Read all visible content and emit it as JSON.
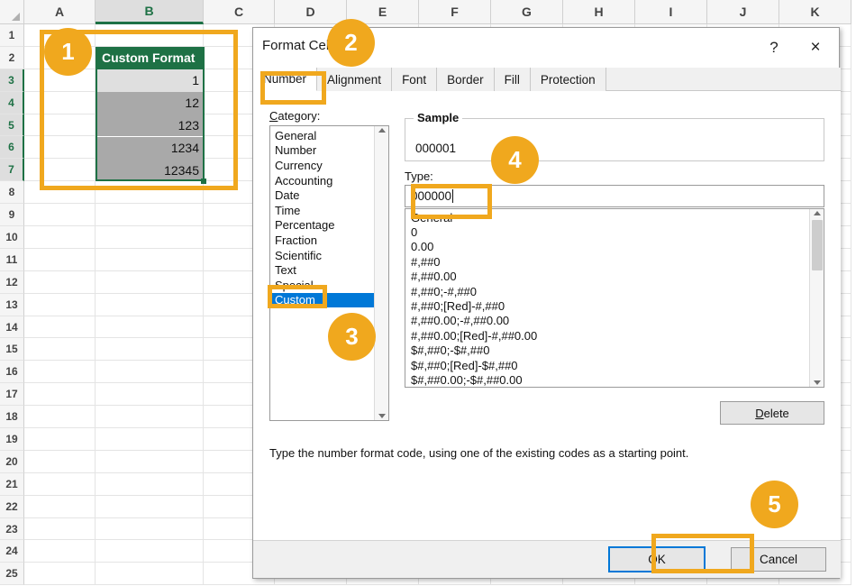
{
  "spreadsheet": {
    "columns": [
      "A",
      "B",
      "C",
      "D",
      "E",
      "F",
      "G",
      "H",
      "I",
      "J",
      "K"
    ],
    "selected_column": "B",
    "rows": [
      "1",
      "2",
      "3",
      "4",
      "5",
      "6",
      "7",
      "8",
      "9",
      "10",
      "11",
      "12",
      "13",
      "14",
      "15",
      "16",
      "17",
      "18",
      "19",
      "20",
      "21",
      "22",
      "23",
      "24",
      "25"
    ],
    "selected_rows": [
      "3",
      "4",
      "5",
      "6",
      "7"
    ],
    "header_cell": {
      "value": "Custom Format",
      "bg": "#1e7145",
      "fg": "#ffffff"
    },
    "data_cells": [
      {
        "row": "3",
        "value": "1",
        "state": "active"
      },
      {
        "row": "4",
        "value": "12",
        "state": "selected"
      },
      {
        "row": "5",
        "value": "123",
        "state": "selected"
      },
      {
        "row": "6",
        "value": "1234",
        "state": "selected"
      },
      {
        "row": "7",
        "value": "12345",
        "state": "selected"
      }
    ]
  },
  "dialog": {
    "title": "Format Cells",
    "help_icon": "?",
    "close_icon": "×",
    "tabs": [
      {
        "label": "Number",
        "active": true
      },
      {
        "label": "Alignment",
        "active": false
      },
      {
        "label": "Font",
        "active": false
      },
      {
        "label": "Border",
        "active": false
      },
      {
        "label": "Fill",
        "active": false
      },
      {
        "label": "Protection",
        "active": false
      }
    ],
    "category": {
      "label": "Category:",
      "items": [
        "General",
        "Number",
        "Currency",
        "Accounting",
        "Date",
        "Time",
        "Percentage",
        "Fraction",
        "Scientific",
        "Text",
        "Special",
        "Custom"
      ],
      "selected": "Custom"
    },
    "sample": {
      "legend": "Sample",
      "value": "000001"
    },
    "type": {
      "label": "Type:",
      "value": "000000"
    },
    "format_codes": [
      "General",
      "0",
      "0.00",
      "#,##0",
      "#,##0.00",
      "#,##0;-#,##0",
      "#,##0;[Red]-#,##0",
      "#,##0.00;-#,##0.00",
      "#,##0.00;[Red]-#,##0.00",
      "$#,##0;-$#,##0",
      "$#,##0;[Red]-$#,##0",
      "$#,##0.00;-$#,##0.00"
    ],
    "delete_label": "Delete",
    "hint": "Type the number format code, using one of the existing codes as a starting point.",
    "ok_label": "OK",
    "cancel_label": "Cancel"
  },
  "annotations": {
    "accent": "#f0a81e",
    "badges": [
      {
        "number": "1"
      },
      {
        "number": "2"
      },
      {
        "number": "3"
      },
      {
        "number": "4"
      },
      {
        "number": "5"
      }
    ]
  }
}
